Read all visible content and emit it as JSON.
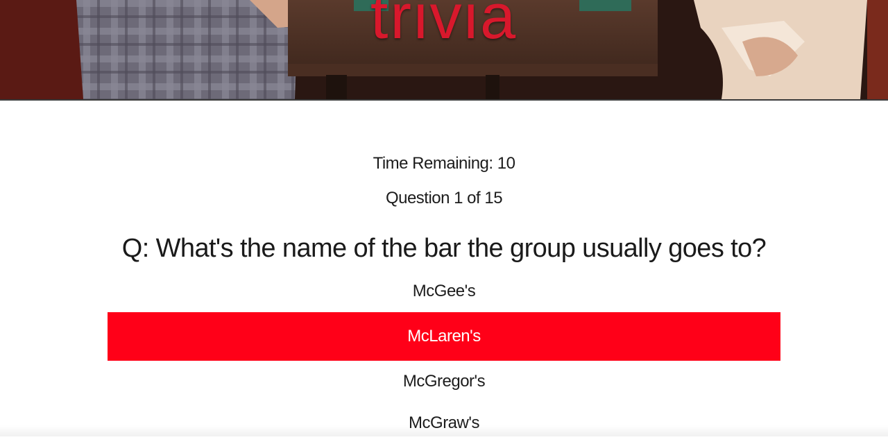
{
  "banner": {
    "title": "trivia"
  },
  "quiz": {
    "timer_text": "Time Remaining: 10",
    "counter_text": "Question 1 of 15",
    "question_text": "Q: What's the name of the bar the group usually goes to?",
    "answers": [
      {
        "label": "McGee's",
        "selected": false
      },
      {
        "label": "McLaren's",
        "selected": true
      },
      {
        "label": "McGregor's",
        "selected": false
      },
      {
        "label": "McGraw's",
        "selected": false
      }
    ]
  },
  "colors": {
    "accent": "#ff0018",
    "banner_title": "#d8182c",
    "text": "#1c1c1c",
    "background": "#ffffff"
  }
}
